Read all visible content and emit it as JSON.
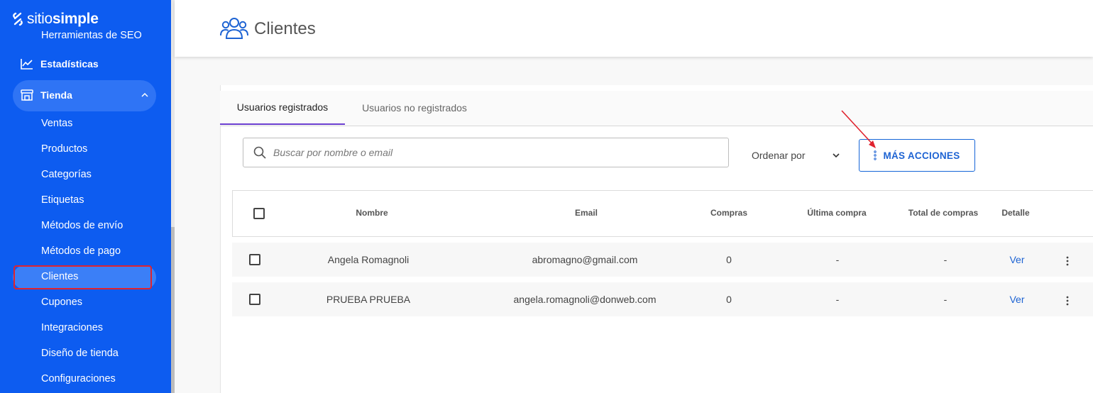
{
  "brand": {
    "prefix": "sitio",
    "suffix": "simple"
  },
  "sidebar": {
    "seo_label": "Herramientas de SEO",
    "stats_label": "Estadísticas",
    "store_label": "Tienda",
    "sub_items": [
      {
        "label": "Ventas"
      },
      {
        "label": "Productos"
      },
      {
        "label": "Categorías"
      },
      {
        "label": "Etiquetas"
      },
      {
        "label": "Métodos de envío"
      },
      {
        "label": "Métodos de pago"
      },
      {
        "label": "Clientes"
      },
      {
        "label": "Cupones"
      },
      {
        "label": "Integraciones"
      },
      {
        "label": "Diseño de tienda"
      },
      {
        "label": "Configuraciones"
      }
    ]
  },
  "header": {
    "title": "Clientes",
    "icon": "users-icon"
  },
  "tabs": [
    {
      "label": "Usuarios registrados",
      "active": true
    },
    {
      "label": "Usuarios no registrados",
      "active": false
    }
  ],
  "search": {
    "placeholder": "Buscar por nombre o email",
    "value": ""
  },
  "order": {
    "label": "Ordenar por"
  },
  "more_actions": {
    "label": "MÁS ACCIONES"
  },
  "table": {
    "columns": [
      "Nombre",
      "Email",
      "Compras",
      "Última compra",
      "Total de compras",
      "Detalle"
    ],
    "rows": [
      {
        "name": "Angela Romagnoli",
        "email": "abromagno@gmail.com",
        "purchases": "0",
        "last": "-",
        "total": "-",
        "detail": "Ver"
      },
      {
        "name": "PRUEBA PRUEBA",
        "email": "angela.romagnoli@donweb.com",
        "purchases": "0",
        "last": "-",
        "total": "-",
        "detail": "Ver"
      }
    ]
  },
  "colors": {
    "sidebar": "#0d5cf0",
    "accent": "#1d63d3",
    "tab_indicator": "#6b3fd0",
    "highlight": "#e0232e"
  }
}
